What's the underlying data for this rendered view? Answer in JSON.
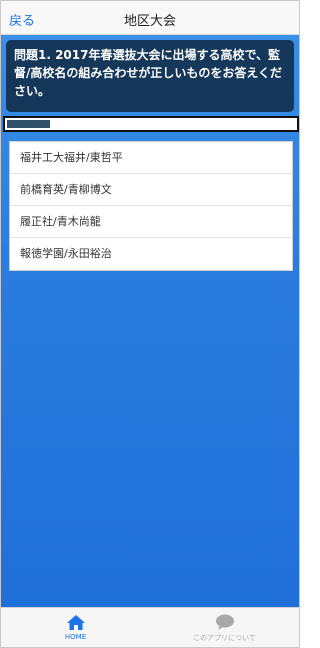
{
  "header": {
    "back_label": "戻る",
    "title": "地区大会"
  },
  "question": {
    "text": "問題1. 2017年春選抜大会に出場する高校で、監督/高校名の組み合わせが正しいものをお答えください。"
  },
  "progress": {
    "value": 0.15
  },
  "answers": [
    {
      "label": "福井工大福井/東哲平"
    },
    {
      "label": "前橋育英/青柳博文"
    },
    {
      "label": "履正社/青木尚龍"
    },
    {
      "label": "報徳学園/永田裕治"
    }
  ],
  "tabbar": {
    "tabs": [
      {
        "label": "HOME",
        "icon": "home-icon",
        "color": "#1a73e8"
      },
      {
        "label": "このアプリについて",
        "icon": "chat-bubble-icon",
        "color": "#a8a8a8"
      }
    ]
  },
  "colors": {
    "accent": "#1a73e8",
    "question_bg": "#14375a",
    "background_gradient_top": "#3a8fe6",
    "background_gradient_bottom": "#1f6fd8"
  }
}
